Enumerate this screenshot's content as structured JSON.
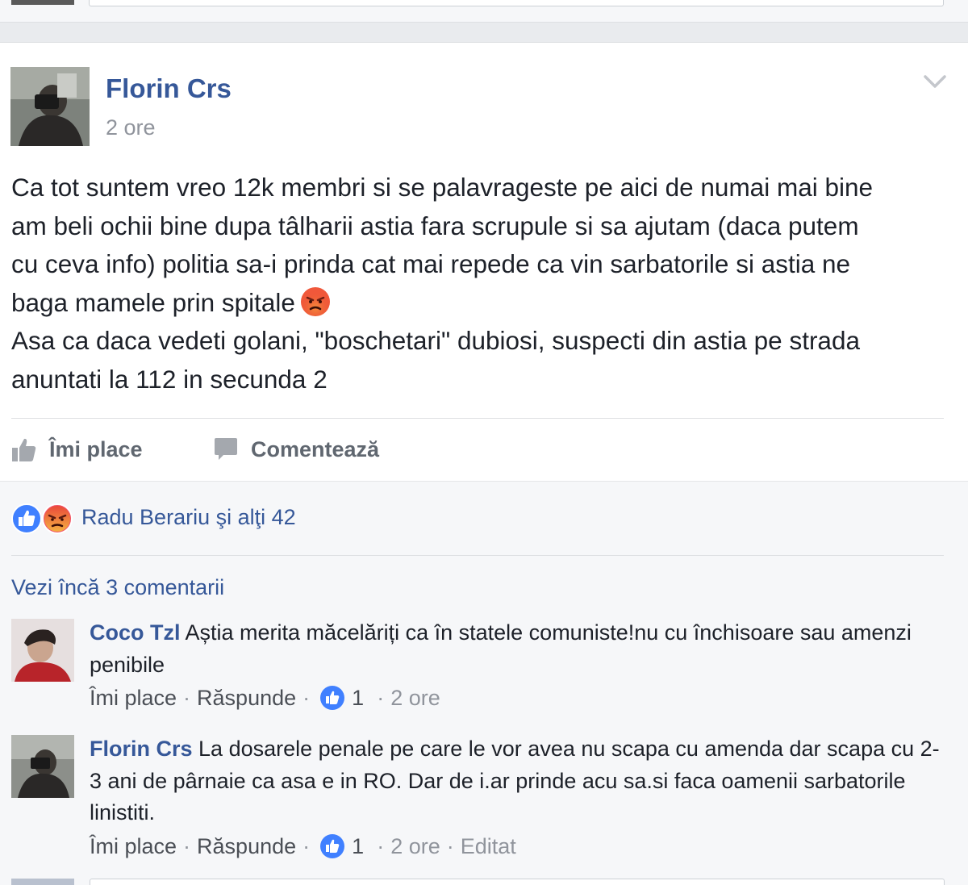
{
  "post": {
    "author": "Florin Crs",
    "time": "2 ore",
    "lines": [
      "Ca tot suntem vreo 12k membri si se palavrageste pe aici de numai mai bine",
      "am beli ochii bine dupa tâlharii astia fara scrupule si sa ajutam (daca putem",
      "cu ceva info) politia sa-i prinda cat mai repede ca vin sarbatorile si astia ne",
      "baga mamele prin spitale",
      "Asa ca daca vedeti golani, \"boschetari\" dubiosi, suspecti din astia pe strada",
      "anuntati la 112 in secunda 2"
    ],
    "actions": {
      "like": "Îmi place",
      "comment": "Comentează"
    }
  },
  "reactions": {
    "summary": "Radu Berariu şi alţi 42",
    "like_color": "#4080ff",
    "angry_color": "#f25268"
  },
  "comments": {
    "view_more": "Vezi încă 3 comentarii",
    "items": [
      {
        "author": "Coco Tzl",
        "text": "Aștia merita măcelăriți ca în statele comuniste!nu cu închisoare sau amenzi penibile",
        "like_label": "Îmi place",
        "reply_label": "Răspunde",
        "likes": "1",
        "time": "2 ore"
      },
      {
        "author": "Florin Crs",
        "text": "La dosarele penale pe care le vor avea nu scapa cu amenda dar scapa cu 2-3 ani de pârnaie ca asa e in RO. Dar de i.ar prinde acu sa.si faca oamenii sarbatorile linistiti.",
        "like_label": "Îmi place",
        "reply_label": "Răspunde",
        "likes": "1",
        "time": "2 ore",
        "edited": "Editat"
      }
    ]
  },
  "icons": {
    "chevron": "chevron-down-icon",
    "like": "thumbs-up-icon",
    "comment": "speech-bubble-icon",
    "angry": "angry-face-emoji"
  },
  "colors": {
    "link": "#365899",
    "secondary": "#90949c",
    "background": "#e9ebee"
  }
}
